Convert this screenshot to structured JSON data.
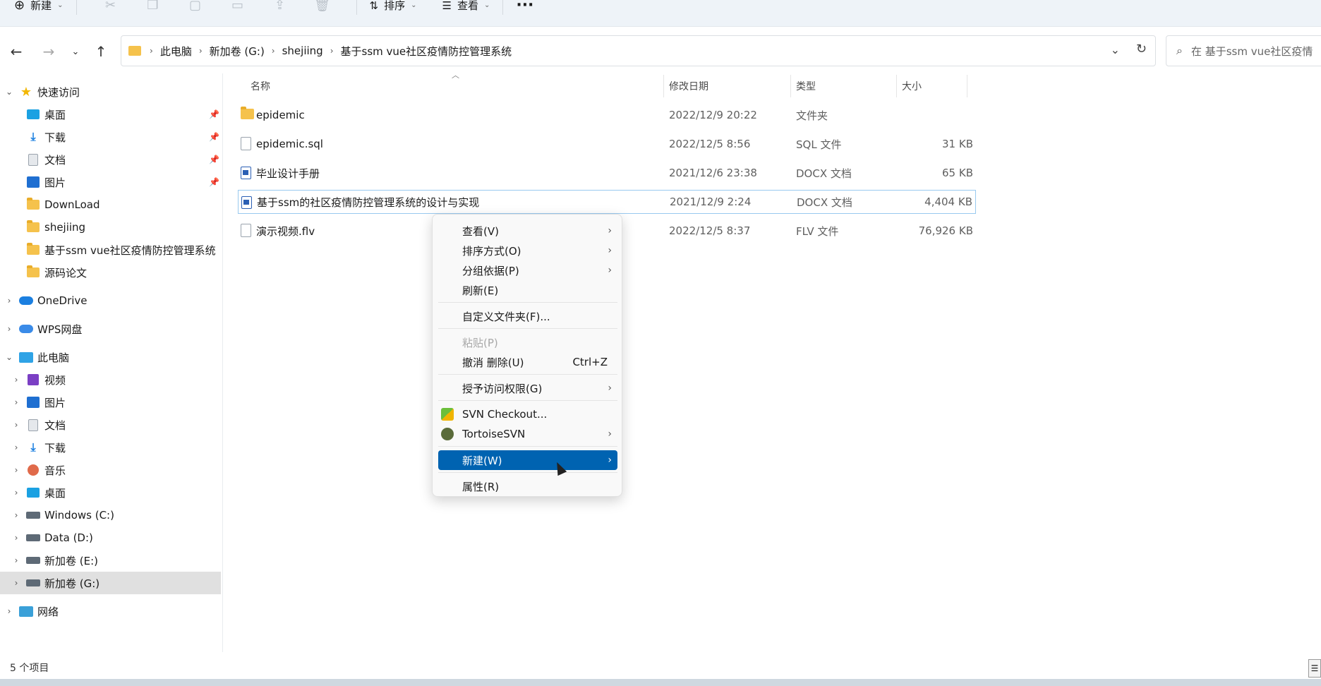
{
  "toolbar": {
    "new_label": "新建",
    "sort_label": "排序",
    "view_label": "查看",
    "more_label": "···"
  },
  "address": {
    "crumbs": [
      "此电脑",
      "新加卷 (G:)",
      "shejiing",
      "基于ssm vue社区疫情防控管理系统"
    ],
    "search_placeholder": "在 基于ssm vue社区疫情"
  },
  "sidebar": {
    "quick_access": "快速访问",
    "quick_items": [
      "桌面",
      "下载",
      "文档",
      "图片",
      "DownLoad",
      "shejiing",
      "基于ssm vue社区疫情防控管理系统",
      "源码论文"
    ],
    "onedrive": "OneDrive",
    "wps": "WPS网盘",
    "this_pc": "此电脑",
    "pc_items": [
      "视频",
      "图片",
      "文档",
      "下载",
      "音乐",
      "桌面",
      "Windows (C:)",
      "Data (D:)",
      "新加卷 (E:)",
      "新加卷 (G:)"
    ],
    "network": "网络"
  },
  "columns": {
    "name": "名称",
    "date": "修改日期",
    "type": "类型",
    "size": "大小"
  },
  "files": [
    {
      "name": "epidemic",
      "date": "2022/12/9 20:22",
      "type": "文件夹",
      "size": ""
    },
    {
      "name": "epidemic.sql",
      "date": "2022/12/5 8:56",
      "type": "SQL 文件",
      "size": "31 KB"
    },
    {
      "name": "毕业设计手册",
      "date": "2021/12/6 23:38",
      "type": "DOCX 文档",
      "size": "65 KB"
    },
    {
      "name": "基于ssm的社区疫情防控管理系统的设计与实现",
      "date": "2021/12/9 2:24",
      "type": "DOCX 文档",
      "size": "4,404 KB"
    },
    {
      "name": "演示视频.flv",
      "date": "2022/12/5 8:37",
      "type": "FLV 文件",
      "size": "76,926 KB"
    }
  ],
  "context_menu": {
    "view": "查看(V)",
    "sort": "排序方式(O)",
    "group": "分组依据(P)",
    "refresh": "刷新(E)",
    "customize": "自定义文件夹(F)...",
    "paste": "粘贴(P)",
    "undo": "撤消 删除(U)",
    "undo_shortcut": "Ctrl+Z",
    "grant": "授予访问权限(G)",
    "svn_checkout": "SVN Checkout...",
    "tortoise": "TortoiseSVN",
    "new": "新建(W)",
    "properties": "属性(R)"
  },
  "status": {
    "count": "5 个项目"
  }
}
